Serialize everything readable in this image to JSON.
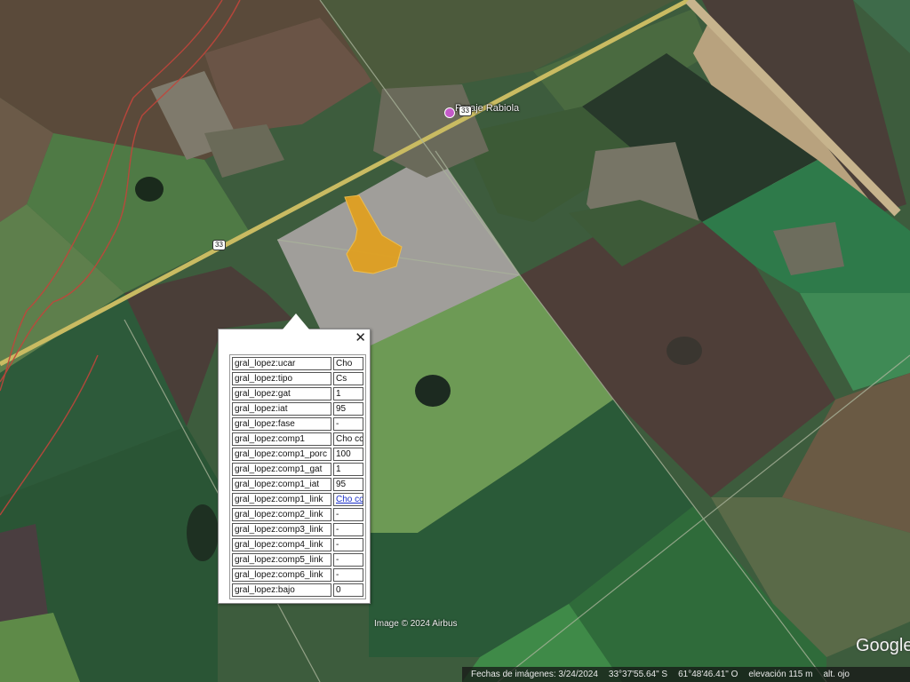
{
  "map": {
    "place_label": "Paraje Rabiola",
    "route_shields": [
      "33",
      "33"
    ],
    "imagery_credit": "Image © 2024 Airbus",
    "google_logo": "Google",
    "colors": {
      "highlight_polygon": "#e0a021",
      "road": "#d8c76a",
      "boundary_line": "#c2453b"
    }
  },
  "status_bar": {
    "imagery_date": "Fechas de imágenes: 3/24/2024",
    "latitude": "33°37'55.64\" S",
    "longitude": "61°48'46.41\" O",
    "elevation": "elevación  115 m",
    "eye_alt": "alt. ojo"
  },
  "popup": {
    "close_glyph": "✕",
    "rows": [
      {
        "key": "gral_lopez:ucar",
        "value": "Cho"
      },
      {
        "key": "gral_lopez:tipo",
        "value": "Cs"
      },
      {
        "key": "gral_lopez:gat",
        "value": "1"
      },
      {
        "key": "gral_lopez:iat",
        "value": "95"
      },
      {
        "key": "gral_lopez:fase",
        "value": "-"
      },
      {
        "key": "gral_lopez:comp1",
        "value": "Cho cc"
      },
      {
        "key": "gral_lopez:comp1_porc",
        "value": "100"
      },
      {
        "key": "gral_lopez:comp1_gat",
        "value": "1"
      },
      {
        "key": "gral_lopez:comp1_iat",
        "value": "95"
      },
      {
        "key": "gral_lopez:comp1_link",
        "value": "Cho cc",
        "link": true
      },
      {
        "key": "gral_lopez:comp2_link",
        "value": "-"
      },
      {
        "key": "gral_lopez:comp3_link",
        "value": "-"
      },
      {
        "key": "gral_lopez:comp4_link",
        "value": "-"
      },
      {
        "key": "gral_lopez:comp5_link",
        "value": "-"
      },
      {
        "key": "gral_lopez:comp6_link",
        "value": "-"
      },
      {
        "key": "gral_lopez:bajo",
        "value": "0"
      }
    ]
  }
}
